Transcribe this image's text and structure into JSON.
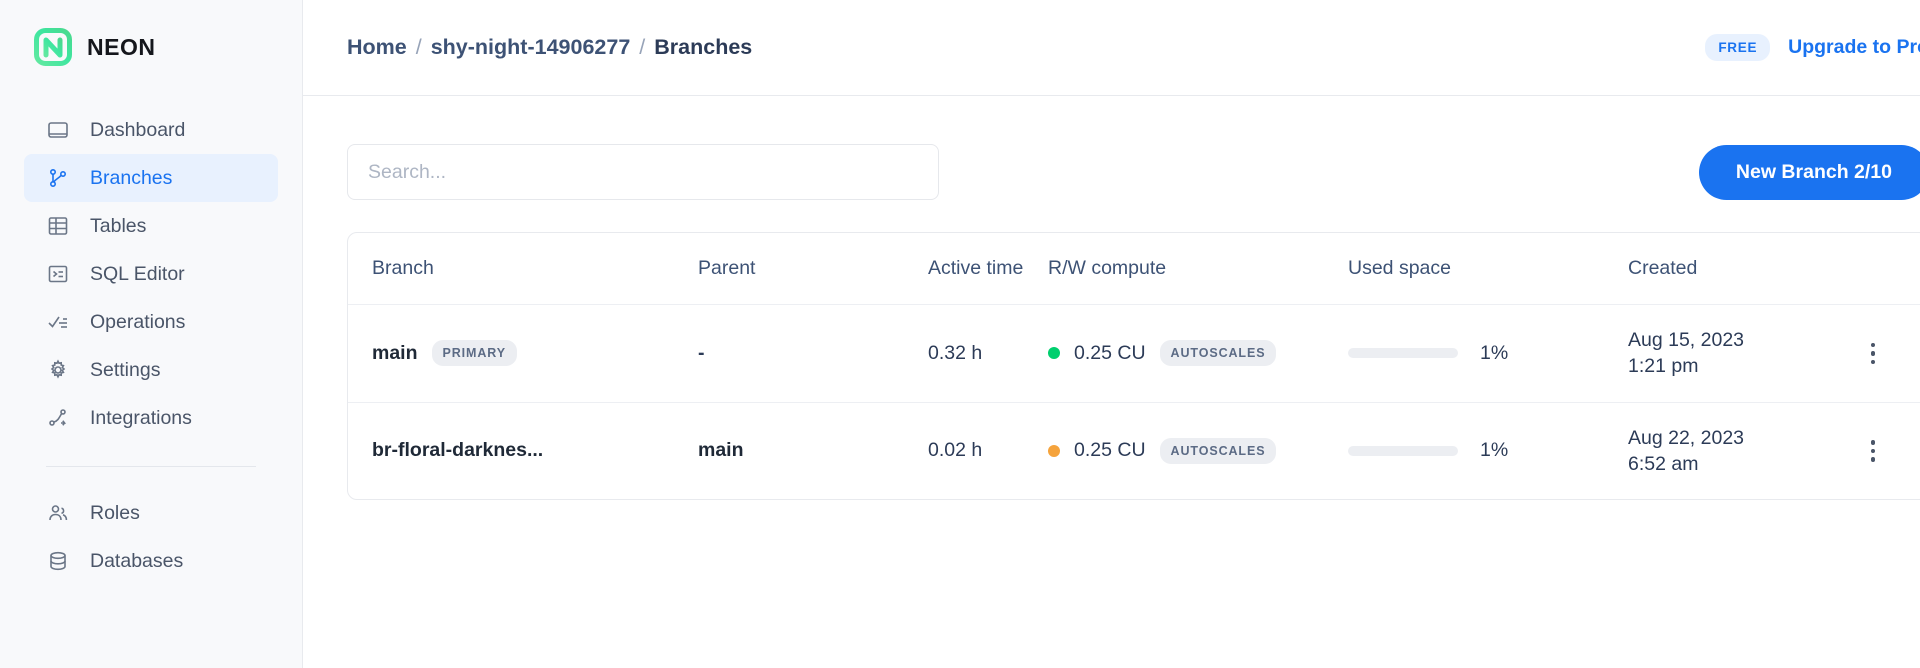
{
  "brand": {
    "name": "NEON",
    "logo_icon": "neon-n-logo",
    "color": "#00e599"
  },
  "sidebar": {
    "items": [
      {
        "label": "Dashboard",
        "icon": "dashboard-icon",
        "active": false
      },
      {
        "label": "Branches",
        "icon": "branches-icon",
        "active": true
      },
      {
        "label": "Tables",
        "icon": "table-icon",
        "active": false
      },
      {
        "label": "SQL Editor",
        "icon": "sql-editor-icon",
        "active": false
      },
      {
        "label": "Operations",
        "icon": "operations-icon",
        "active": false
      },
      {
        "label": "Settings",
        "icon": "gear-icon",
        "active": false
      },
      {
        "label": "Integrations",
        "icon": "integrations-icon",
        "active": false
      }
    ],
    "secondary_items": [
      {
        "label": "Roles",
        "icon": "users-icon"
      },
      {
        "label": "Databases",
        "icon": "database-icon"
      }
    ]
  },
  "topbar": {
    "breadcrumb": {
      "home": "Home",
      "project": "shy-night-14906277",
      "current": "Branches",
      "separator": "/"
    },
    "plan_badge": "FREE",
    "upgrade_label": "Upgrade to Pro",
    "accent_color": "#1a73f0"
  },
  "toolbar": {
    "search_placeholder": "Search...",
    "search_value": "",
    "new_branch_label": "New Branch 2/10"
  },
  "table": {
    "columns": [
      "Branch",
      "Parent",
      "Active time",
      "R/W compute",
      "Used space",
      "Created"
    ],
    "rows": [
      {
        "branch": "main",
        "badge": "PRIMARY",
        "parent": "-",
        "active_time": "0.32 h",
        "compute_status": "green",
        "compute_status_color": "#00cf6e",
        "compute": "0.25 CU",
        "compute_badge": "AUTOSCALES",
        "used_space_pct": "1%",
        "used_space_value": 1,
        "created_date": "Aug 15, 2023",
        "created_time": "1:21 pm",
        "menu_icon": "kebab-menu-icon"
      },
      {
        "branch": "br-floral-darknes...",
        "badge": "",
        "parent": "main",
        "active_time": "0.02 h",
        "compute_status": "orange",
        "compute_status_color": "#f5a33c",
        "compute": "0.25 CU",
        "compute_badge": "AUTOSCALES",
        "used_space_pct": "1%",
        "used_space_value": 1,
        "created_date": "Aug 22, 2023",
        "created_time": "6:52 am",
        "menu_icon": "kebab-menu-icon"
      }
    ]
  }
}
